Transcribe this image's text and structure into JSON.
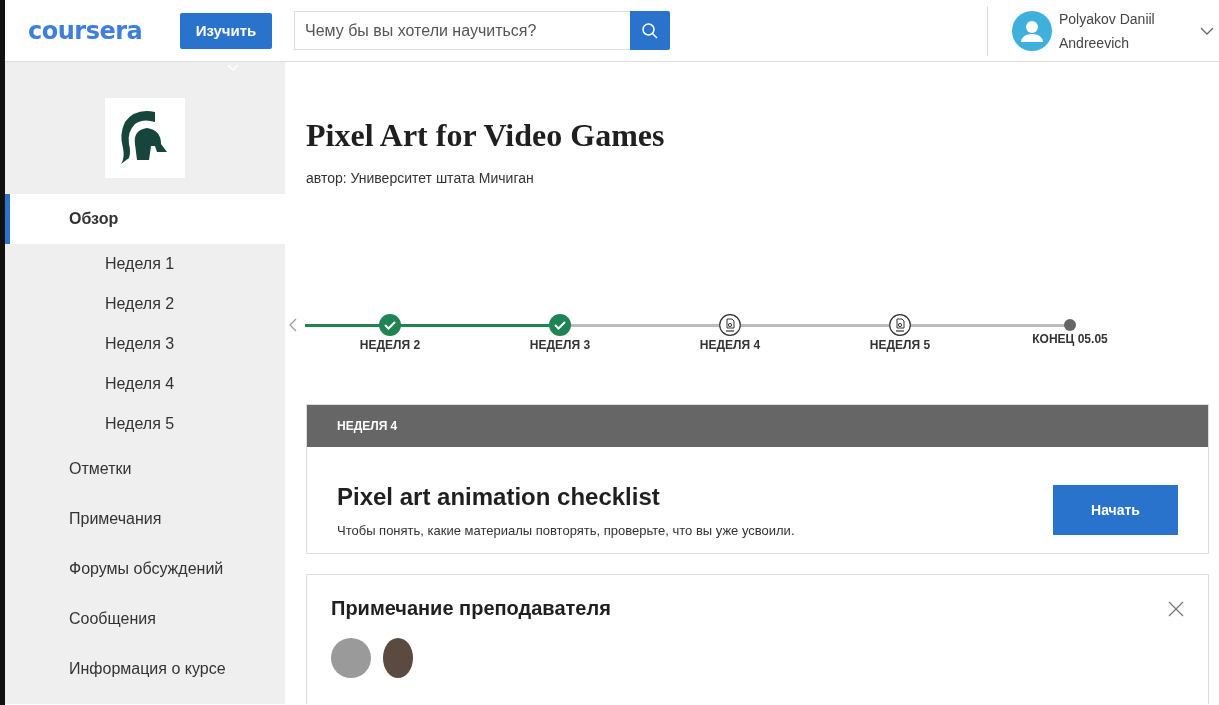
{
  "header": {
    "logo": "coursera",
    "explore_button": "Изучить",
    "search": {
      "placeholder": "Чему бы вы хотели научиться?"
    },
    "user": {
      "name_line_1": "Polyakov Daniil",
      "name_line_2": "Andreevich"
    }
  },
  "sidebar": {
    "items": [
      {
        "label": "Обзор",
        "selected": true,
        "children": [
          {
            "label": "Неделя 1",
            "selected": false
          },
          {
            "label": "Неделя 2",
            "selected": false
          },
          {
            "label": "Неделя 3",
            "selected": false
          },
          {
            "label": "Неделя 4",
            "selected": false
          },
          {
            "label": "Неделя 5",
            "selected": false
          }
        ]
      },
      {
        "label": "Отметки",
        "selected": false
      },
      {
        "label": "Примечания",
        "selected": false
      },
      {
        "label": "Форумы обсуждений",
        "selected": false
      },
      {
        "label": "Сообщения",
        "selected": false
      },
      {
        "label": "Информация о курсе",
        "selected": false
      }
    ]
  },
  "course": {
    "title": "Pixel Art for Video Games",
    "author": "автор: Университет штата Мичиган"
  },
  "timeline": [
    {
      "label": "НЕДЕЛЯ 2",
      "kind": "done"
    },
    {
      "label": "НЕДЕЛЯ 3",
      "kind": "done"
    },
    {
      "label": "НЕДЕЛЯ 4",
      "kind": "assignment"
    },
    {
      "label": "НЕДЕЛЯ 5",
      "kind": "assignment"
    },
    {
      "label": "КОНЕЦ 05.05",
      "kind": "end"
    }
  ],
  "next_item": {
    "week": "НЕДЕЛЯ 4",
    "title": "Pixel art animation checklist",
    "description": "Чтобы понять, какие материалы повторять, проверьте, что вы уже усвоили.",
    "button": "Начать"
  },
  "instructor_note": {
    "title": "Примечание преподавателя"
  }
}
